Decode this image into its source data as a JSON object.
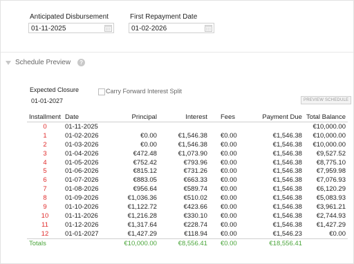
{
  "disbursement": {
    "label": "Anticipated Disbursement",
    "value": "01-11-2025"
  },
  "first_repayment": {
    "label": "First Repayment Date",
    "value": "01-02-2026"
  },
  "schedule_preview": {
    "title": "Schedule Preview",
    "help_glyph": "?"
  },
  "expected_closure": {
    "label": "Expected Closure",
    "value": "01-01-2027"
  },
  "carry_forward": {
    "label": "Carry Forward Interest Split",
    "checked": false
  },
  "preview_button": {
    "label": "PREVIEW SCHEDULE"
  },
  "table": {
    "headers": [
      "Installment",
      "Date",
      "Principal",
      "Interest",
      "Fees",
      "Payment Due",
      "Total Balance"
    ],
    "rows": [
      [
        "0",
        "01-11-2025",
        "",
        "",
        "",
        "",
        "€10,000.00"
      ],
      [
        "1",
        "01-02-2026",
        "€0.00",
        "€1,546.38",
        "€0.00",
        "€1,546.38",
        "€10,000.00"
      ],
      [
        "2",
        "01-03-2026",
        "€0.00",
        "€1,546.38",
        "€0.00",
        "€1,546.38",
        "€10,000.00"
      ],
      [
        "3",
        "01-04-2026",
        "€472.48",
        "€1,073.90",
        "€0.00",
        "€1,546.38",
        "€9,527.52"
      ],
      [
        "4",
        "01-05-2026",
        "€752.42",
        "€793.96",
        "€0.00",
        "€1,546.38",
        "€8,775.10"
      ],
      [
        "5",
        "01-06-2026",
        "€815.12",
        "€731.26",
        "€0.00",
        "€1,546.38",
        "€7,959.98"
      ],
      [
        "6",
        "01-07-2026",
        "€883.05",
        "€663.33",
        "€0.00",
        "€1,546.38",
        "€7,076.93"
      ],
      [
        "7",
        "01-08-2026",
        "€956.64",
        "€589.74",
        "€0.00",
        "€1,546.38",
        "€6,120.29"
      ],
      [
        "8",
        "01-09-2026",
        "€1,036.36",
        "€510.02",
        "€0.00",
        "€1,546.38",
        "€5,083.93"
      ],
      [
        "9",
        "01-10-2026",
        "€1,122.72",
        "€423.66",
        "€0.00",
        "€1,546.38",
        "€3,961.21"
      ],
      [
        "10",
        "01-11-2026",
        "€1,216.28",
        "€330.10",
        "€0.00",
        "€1,546.38",
        "€2,744.93"
      ],
      [
        "11",
        "01-12-2026",
        "€1,317.64",
        "€228.74",
        "€0.00",
        "€1,546.38",
        "€1,427.29"
      ],
      [
        "12",
        "01-01-2027",
        "€1,427.29",
        "€118.94",
        "€0.00",
        "€1,546.23",
        "€0.00"
      ]
    ],
    "totals": {
      "label": "Totals",
      "principal": "€10,000.00",
      "interest": "€8,556.41",
      "fees": "€0.00",
      "payment_due": "€18,556.41"
    }
  },
  "colors": {
    "installment_number": "#e02a2a",
    "totals": "#4aa53a"
  },
  "icons": {
    "date_picker": "calendar-icon",
    "section_toggle": "collapse-triangle-icon",
    "help": "help-icon"
  }
}
